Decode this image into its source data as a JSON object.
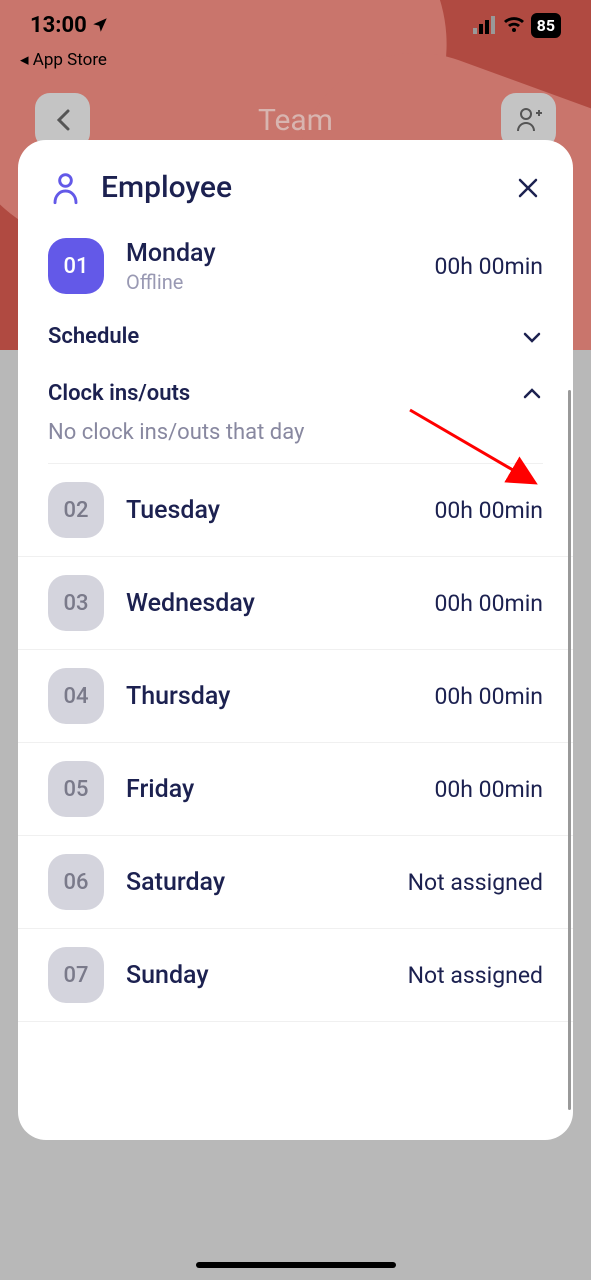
{
  "statusBar": {
    "time": "13:00",
    "battery": "85"
  },
  "backToApp": "◂ App Store",
  "header": {
    "title": "Team"
  },
  "modal": {
    "title": "Employee",
    "sections": {
      "schedule": "Schedule",
      "clockInsOuts": "Clock ins/outs",
      "noClockMessage": "No clock ins/outs that day"
    },
    "selectedDay": {
      "number": "01",
      "name": "Monday",
      "status": "Offline",
      "duration": "00h 00min"
    },
    "days": [
      {
        "number": "02",
        "name": "Tuesday",
        "duration": "00h 00min"
      },
      {
        "number": "03",
        "name": "Wednesday",
        "duration": "00h 00min"
      },
      {
        "number": "04",
        "name": "Thursday",
        "duration": "00h 00min"
      },
      {
        "number": "05",
        "name": "Friday",
        "duration": "00h 00min"
      },
      {
        "number": "06",
        "name": "Saturday",
        "duration": "Not assigned"
      },
      {
        "number": "07",
        "name": "Sunday",
        "duration": "Not assigned"
      }
    ]
  }
}
